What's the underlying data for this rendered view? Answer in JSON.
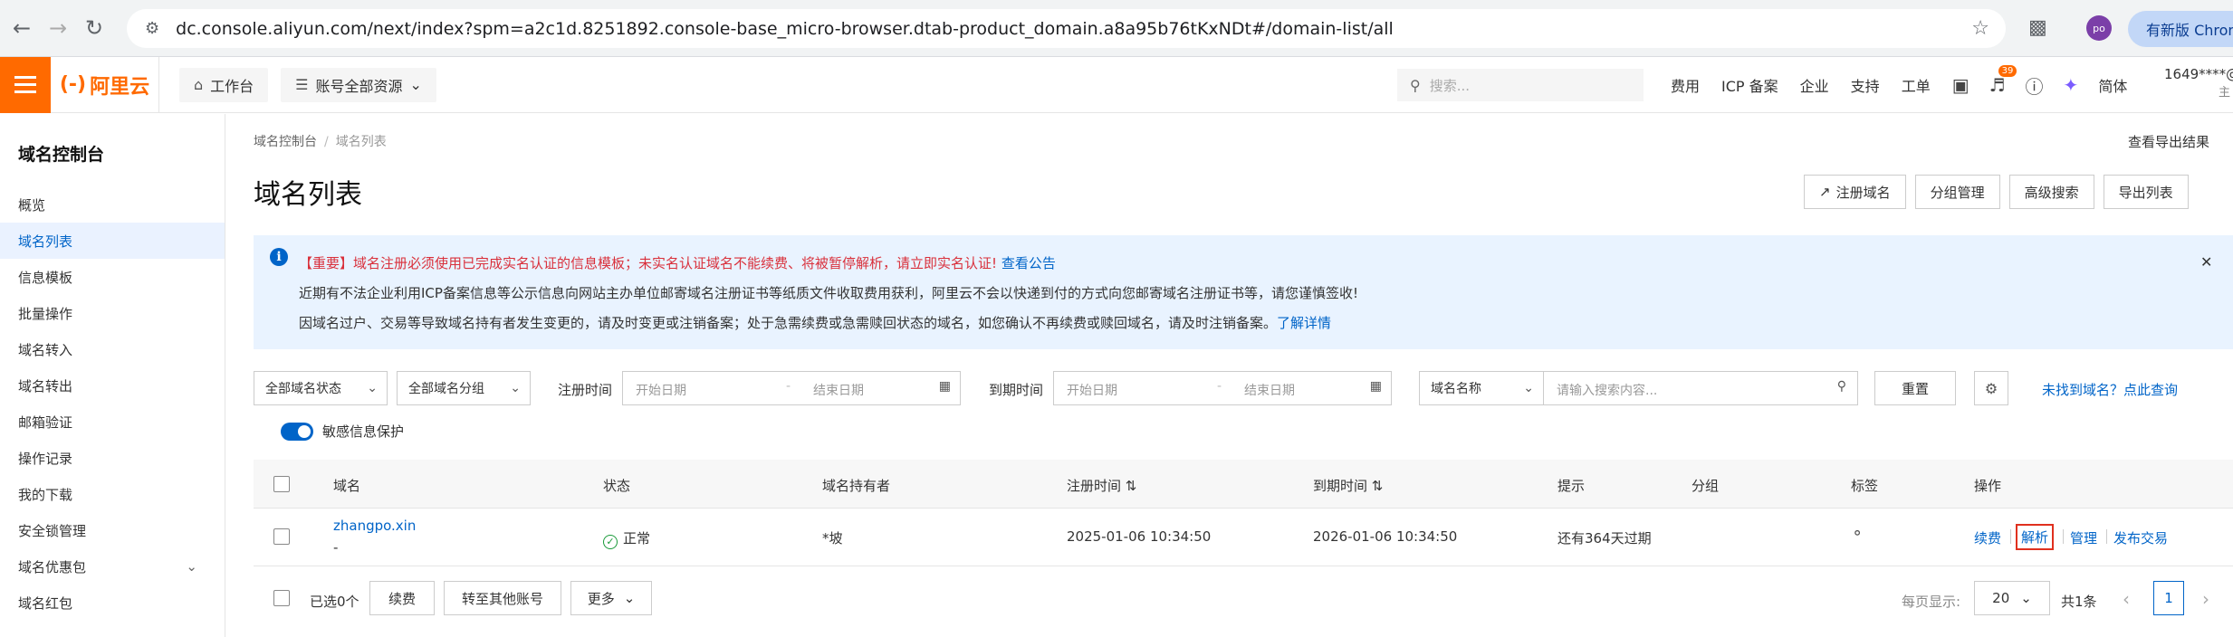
{
  "browser": {
    "url": "dc.console.aliyun.com/next/index?spm=a2c1d.8251892.console-base_micro-browser.dtab-product_domain.a8a95b76tKxNDt#/domain-list/all",
    "profile_initials": "po",
    "new_version_label": "有新版 Chrome"
  },
  "topbar": {
    "logo_text": "阿里云",
    "logo_mark": "(-)",
    "workbench_label": "工作台",
    "resources_label": "账号全部资源",
    "search_placeholder": "搜索...",
    "links": [
      "费用",
      "ICP 备案",
      "企业",
      "支持",
      "工单"
    ],
    "notification_count": "39",
    "lang_label": "简体",
    "account_name": "1649****@",
    "account_sub": "主"
  },
  "sidebar": {
    "title": "域名控制台",
    "items": [
      {
        "label": "概览"
      },
      {
        "label": "域名列表"
      },
      {
        "label": "信息模板"
      },
      {
        "label": "批量操作"
      },
      {
        "label": "域名转入"
      },
      {
        "label": "域名转出"
      },
      {
        "label": "邮箱验证"
      },
      {
        "label": "操作记录"
      },
      {
        "label": "我的下载"
      },
      {
        "label": "安全锁管理"
      },
      {
        "label": "域名优惠包"
      },
      {
        "label": "域名红包"
      }
    ]
  },
  "main": {
    "breadcrumb": [
      "域名控制台",
      "域名列表"
    ],
    "export_results": "查看导出结果",
    "page_title": "域名列表",
    "header_buttons": {
      "register": "注册域名",
      "group_manage": "分组管理",
      "advanced_search": "高级搜索",
      "export_list": "导出列表"
    },
    "notice": {
      "line1": "【重要】域名注册必须使用已完成实名认证的信息模板；未实名认证域名不能续费、将被暂停解析，请立即实名认证!",
      "line1_link": "查看公告",
      "line2": "近期有不法企业利用ICP备案信息等公示信息向网站主办单位邮寄域名注册证书等纸质文件收取费用获利，阿里云不会以快递到付的方式向您邮寄域名注册证书等，请您谨慎签收!",
      "line3": "因域名过户、交易等导致域名持有者发生变更的，请及时变更或注销备案；处于急需续费或急需赎回状态的域名，如您确认不再续费或赎回域名，请及时注销备案。",
      "line3_link": "了解详情"
    },
    "filters": {
      "status": "全部域名状态",
      "group": "全部域名分组",
      "reg_time_label": "注册时间",
      "expire_time_label": "到期时间",
      "start_date": "开始日期",
      "end_date": "结束日期",
      "search_field": "域名名称",
      "search_placeholder": "请输入搜索内容...",
      "reset": "重置",
      "not_found": "未找到域名？点此查询"
    },
    "privacy_toggle": {
      "label": "敏感信息保护",
      "on": true
    },
    "table": {
      "columns": [
        "域名",
        "状态",
        "域名持有者",
        "注册时间",
        "到期时间",
        "提示",
        "分组",
        "标签",
        "操作"
      ],
      "rows": [
        {
          "domain": "zhangpo.xin",
          "domain_sub": "-",
          "status": "正常",
          "owner": "*坡",
          "reg_time": "2025-01-06 10:34:50",
          "expire_time": "2026-01-06 10:34:50",
          "hint": "还有364天过期",
          "group": "",
          "actions": [
            "续费",
            "解析",
            "管理",
            "发布交易"
          ]
        }
      ]
    },
    "footer": {
      "selected": "已选0个",
      "renew": "续费",
      "transfer": "转至其他账号",
      "more": "更多",
      "per_page_label": "每页显示:",
      "per_page": "20",
      "total": "共1条",
      "current_page": "1"
    }
  },
  "colors": {
    "brand": "#ff6a00",
    "link": "#0064c8",
    "highlight_border": "#e0301e"
  }
}
